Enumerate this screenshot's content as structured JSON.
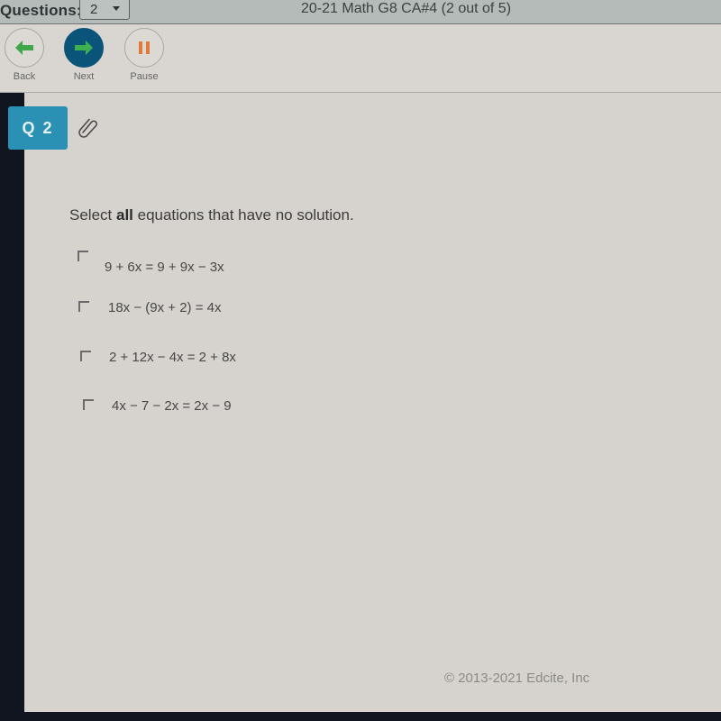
{
  "header": {
    "questions_label": "Questions:",
    "question_select_value": "2",
    "test_title": "20-21 Math G8 CA#4 (2 out of 5)"
  },
  "toolbar": {
    "back_label": "Back",
    "next_label": "Next",
    "pause_label": "Pause",
    "colors": {
      "back_arrow": "#3fa64a",
      "next_bg": "#0a5479",
      "next_arrow": "#3fb04f",
      "pause": "#e07a3a"
    }
  },
  "question": {
    "badge": "Q 2",
    "attachment_icon": "paperclip-icon",
    "prompt_before": "Select ",
    "prompt_bold": "all",
    "prompt_after": " equations that have no solution.",
    "options": [
      {
        "text": "9 + 6x = 9 + 9x − 3x",
        "checked": false
      },
      {
        "text": "18x − (9x + 2) = 4x",
        "checked": false
      },
      {
        "text": "2 + 12x − 4x = 2 + 8x",
        "checked": false
      },
      {
        "text": "4x − 7 − 2x = 2x − 9",
        "checked": false
      }
    ]
  },
  "footer": {
    "copyright": "© 2013-2021 Edcite, Inc"
  }
}
